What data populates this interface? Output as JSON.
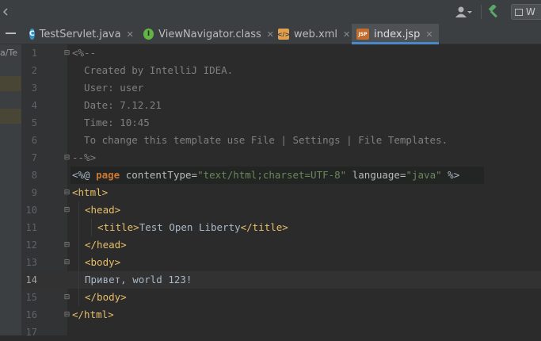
{
  "header": {
    "partial_button_label": "W"
  },
  "left_panel": {
    "path_fragment": "a/Te"
  },
  "tabs": [
    {
      "label": "TestServlet.java",
      "icon": "class-c-icon",
      "active": false
    },
    {
      "label": "ViewNavigator.class",
      "icon": "interface-i-icon",
      "active": false
    },
    {
      "label": "web.xml",
      "icon": "xml-file-icon",
      "active": false
    },
    {
      "label": "index.jsp",
      "icon": "jsp-file-icon",
      "active": true
    }
  ],
  "editor": {
    "current_line": 14,
    "line_numbers": [
      "1",
      "2",
      "3",
      "4",
      "5",
      "6",
      "7",
      "8",
      "9",
      "10",
      "11",
      "12",
      "13",
      "14",
      "15",
      "16",
      "17"
    ],
    "lines": {
      "l1": "<%--",
      "l2": "  Created by IntelliJ IDEA.",
      "l3": "  User: user",
      "l4": "  Date: 7.12.21",
      "l5": "  Time: 10:45",
      "l6": "  To change this template use File | Settings | File Templates.",
      "l7": "--%>",
      "l8_open": "<%@ ",
      "l8_kw": "page",
      "l8_attr1": " contentType=",
      "l8_val1": "\"text/html;charset=UTF-8\"",
      "l8_attr2": " language=",
      "l8_val2": "\"java\"",
      "l8_close": " %>",
      "l9": "<html>",
      "l10": "<head>",
      "l11_open": "<title>",
      "l11_text": "Test Open Liberty",
      "l11_close": "</title>",
      "l12": "</head>",
      "l13": "<body>",
      "l14": "Привет, world 123!",
      "l15": "</body>",
      "l16": "</html>"
    }
  },
  "colors": {
    "background": "#2b2b2b",
    "gutter": "#313335",
    "comment": "#808080",
    "tag": "#e8bf6a",
    "keyword": "#cc7832",
    "string": "#6a8759",
    "text": "#a9b7c6",
    "active_tab_underline": "#4a88c7"
  }
}
